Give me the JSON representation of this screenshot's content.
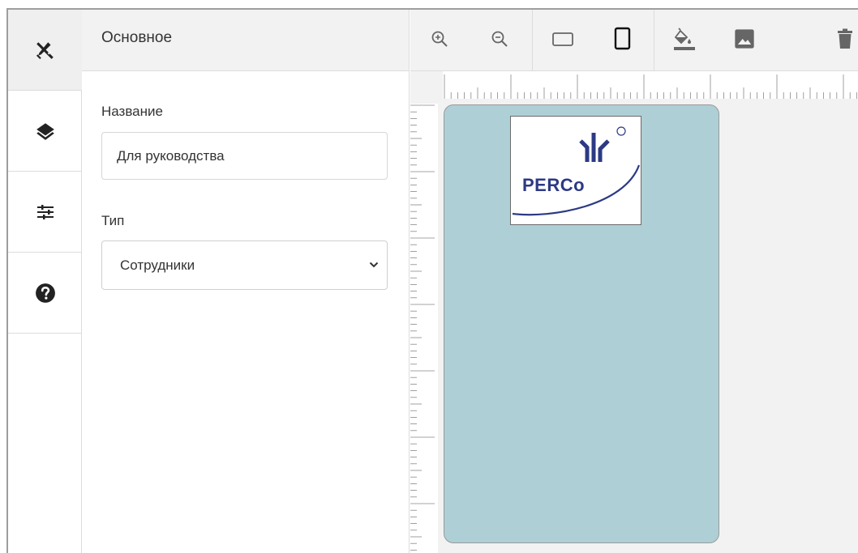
{
  "panel": {
    "title": "Основное",
    "name_label": "Название",
    "name_value": "Для руководства",
    "type_label": "Тип",
    "type_value": "Сотрудники"
  },
  "rail": {
    "items": [
      {
        "icon": "design-tools-icon",
        "active": true
      },
      {
        "icon": "layers-icon",
        "active": false
      },
      {
        "icon": "sliders-icon",
        "active": false
      },
      {
        "icon": "help-icon",
        "active": false
      }
    ]
  },
  "toolbar": {
    "buttons": [
      "zoom-in-icon",
      "zoom-out-icon",
      "landscape-icon",
      "portrait-icon",
      "fill-color-icon",
      "image-icon",
      "delete-icon"
    ]
  },
  "card": {
    "background": "#aecfd5",
    "logo_text": "PERCo"
  }
}
